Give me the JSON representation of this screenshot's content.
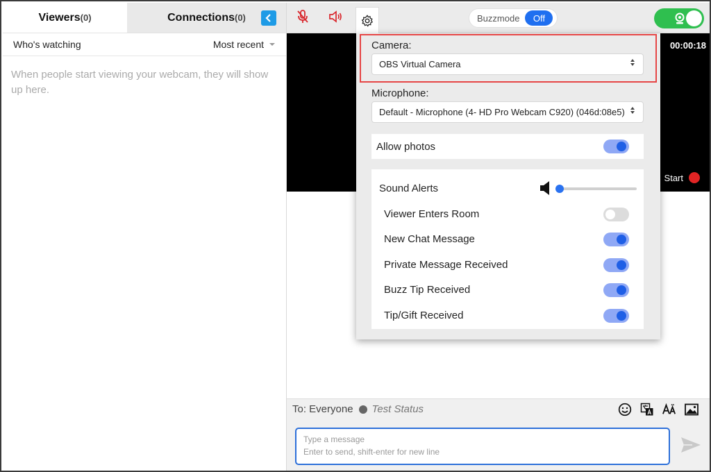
{
  "left": {
    "tabs": [
      {
        "label": "Viewers",
        "count": "(0)"
      },
      {
        "label": "Connections",
        "count": "(0)"
      }
    ],
    "subheader": {
      "title": "Who's watching",
      "sort": "Most recent"
    },
    "empty_message": "When people start viewing your webcam, they will show up here."
  },
  "topbar": {
    "buzzmode_label": "Buzzmode",
    "buzzmode_value": "Off",
    "icons": [
      "chevron-left-icon",
      "microphone-muted-icon",
      "speaker-muted-icon",
      "gear-icon",
      "webcam-icon"
    ],
    "colors": {
      "collapse": "#1e9be6",
      "muted": "#d9262c",
      "buzz_off": "#1f6ff0",
      "live": "#2fbf4f"
    }
  },
  "video": {
    "timer": "00:00:18",
    "start_label": "Start"
  },
  "settings": {
    "camera_label": "Camera:",
    "camera_value": "OBS Virtual Camera",
    "microphone_label": "Microphone:",
    "microphone_value": "Default - Microphone (4- HD Pro Webcam C920) (046d:08e5)",
    "allow_photos": {
      "label": "Allow photos",
      "on": true
    },
    "sound_alerts": {
      "label": "Sound Alerts",
      "volume": 0.0
    },
    "alerts": [
      {
        "label": "Viewer Enters Room",
        "on": false
      },
      {
        "label": "New Chat Message",
        "on": true
      },
      {
        "label": "Private Message Received",
        "on": true
      },
      {
        "label": "Buzz Tip Received",
        "on": true
      },
      {
        "label": "Tip/Gift Received",
        "on": true
      }
    ]
  },
  "chat": {
    "to_label": "To: Everyone",
    "status": "Test Status",
    "placeholder_line1": "Type a message",
    "placeholder_line2": "Enter to send, shift-enter for new line"
  }
}
